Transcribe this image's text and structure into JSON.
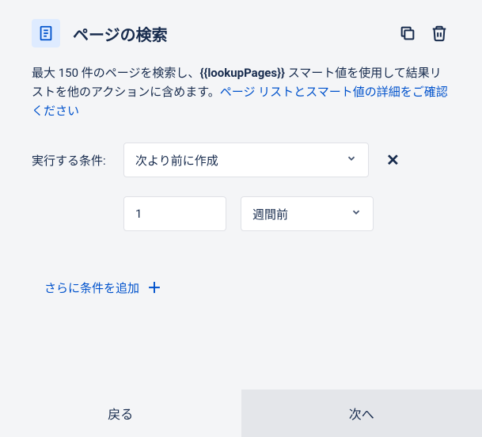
{
  "header": {
    "title": "ページの検索"
  },
  "description": {
    "part1": "最大 150 件のページを検索し、",
    "bold": "{{lookupPages}}",
    "part2": " スマート値を使用して結果リストを他のアクションに含めます。",
    "link": "ページ リストとスマート値の詳細をご確認ください"
  },
  "condition": {
    "label": "実行する条件:",
    "operator": "次より前に作成",
    "value": "1",
    "unit": "週間前"
  },
  "addCondition": "さらに条件を追加",
  "footer": {
    "back": "戻る",
    "next": "次へ"
  }
}
